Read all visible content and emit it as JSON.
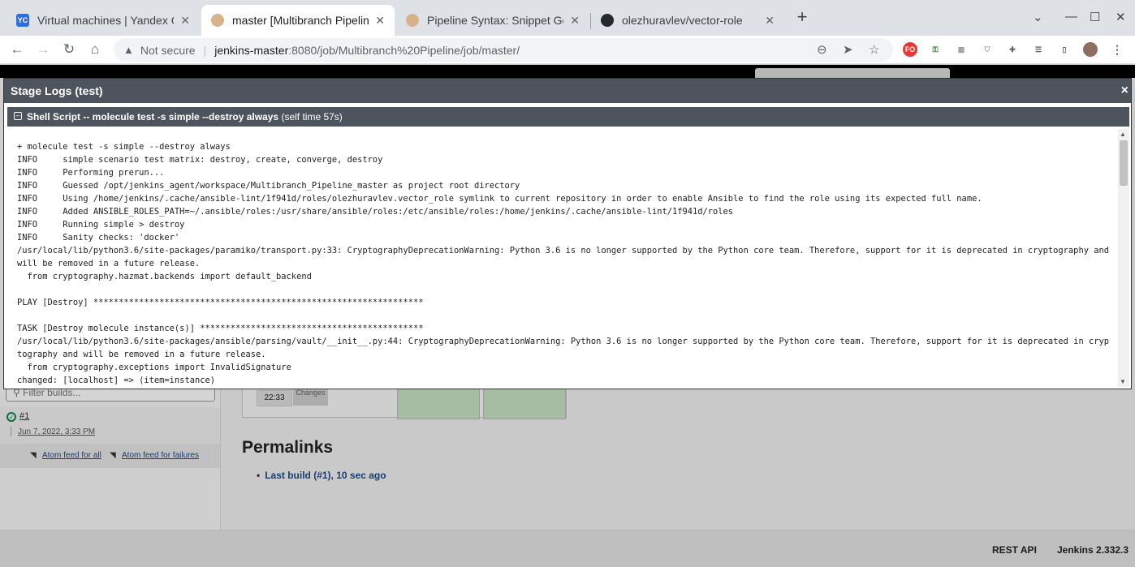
{
  "browser": {
    "tabs": [
      {
        "title": "Virtual machines | Yandex Com",
        "favicon": "YC",
        "active": false
      },
      {
        "title": "master [Multibranch Pipeline]",
        "favicon": "jenkins-icon",
        "active": true
      },
      {
        "title": "Pipeline Syntax: Snippet Gener",
        "favicon": "jenkins-icon",
        "active": false
      },
      {
        "title": "olezhuravlev/vector-role",
        "favicon": "github-icon",
        "active": false
      }
    ],
    "address": {
      "security": "Not secure",
      "host": "jenkins-master",
      "path": ":8080/job/Multibranch%20Pipeline/job/master/"
    },
    "ext_fo": "FO"
  },
  "jenkins": {
    "filter_placeholder": "Filter builds...",
    "build_number": "#1",
    "build_date": "Jun 7, 2022, 3:33 PM",
    "feed_all": "Atom feed for all",
    "feed_failures": "Atom feed for failures",
    "stage_time": "22:33",
    "stage_changes": "Changes",
    "permalinks_title": "Permalinks",
    "permalink_last": "Last build (#1), 10 sec ago",
    "footer_rest": "REST API",
    "footer_version": "Jenkins 2.332.3"
  },
  "modal": {
    "title": "Stage Logs (test)",
    "close": "×",
    "step_name": "Shell Script -- molecule test -s simple --destroy always",
    "step_time": "(self time 57s)",
    "log_lines": [
      "+ molecule test -s simple --destroy always",
      "INFO     simple scenario test matrix: destroy, create, converge, destroy",
      "INFO     Performing prerun...",
      "INFO     Guessed /opt/jenkins_agent/workspace/Multibranch_Pipeline_master as project root directory",
      "INFO     Using /home/jenkins/.cache/ansible-lint/1f941d/roles/olezhuravlev.vector_role symlink to current repository in order to enable Ansible to find the role using its expected full name.",
      "INFO     Added ANSIBLE_ROLES_PATH=~/.ansible/roles:/usr/share/ansible/roles:/etc/ansible/roles:/home/jenkins/.cache/ansible-lint/1f941d/roles",
      "INFO     Running simple > destroy",
      "INFO     Sanity checks: 'docker'",
      "/usr/local/lib/python3.6/site-packages/paramiko/transport.py:33: CryptographyDeprecationWarning: Python 3.6 is no longer supported by the Python core team. Therefore, support for it is deprecated in cryptography and",
      "will be removed in a future release.",
      "  from cryptography.hazmat.backends import default_backend",
      "",
      "PLAY [Destroy] *****************************************************************",
      "",
      "TASK [Destroy molecule instance(s)] ********************************************",
      "/usr/local/lib/python3.6/site-packages/ansible/parsing/vault/__init__.py:44: CryptographyDeprecationWarning: Python 3.6 is no longer supported by the Python core team. Therefore, support for it is deprecated in cryp",
      "tography and will be removed in a future release.",
      "  from cryptography.exceptions import InvalidSignature",
      "changed: [localhost] => (item=instance)"
    ]
  }
}
